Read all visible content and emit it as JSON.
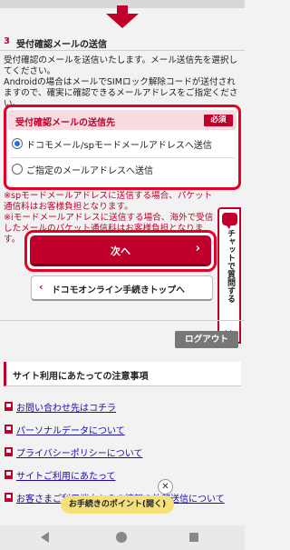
{
  "section": {
    "number": "3",
    "title": "受付確認メールの送信",
    "description": [
      "受付確認のメールを送信いたします。メール送信先を選択してください。",
      "Androidの場合はメールでSIMロック解除コードが送付されますので、確実に確認できるメールアドレスをご指定ください。"
    ]
  },
  "destination": {
    "header": "受付確認メールの送信先",
    "required_badge": "必須",
    "options": [
      {
        "label": "ドコモメール/spモードメールアドレスへ送信",
        "selected": true
      },
      {
        "label": "ご指定のメールアドレスへ送信",
        "selected": false
      }
    ]
  },
  "notes": [
    "※spモードメールアドレスに送信する場合、パケット通信料はお客様負担となります。",
    "※iモードメールアドレスに送信する場合、海外で受信したメールのパケット通信料はお客様負担となります。"
  ],
  "buttons": {
    "next": "次へ",
    "next_chevron": "›",
    "back": "ドコモオンライン手続きトップへ",
    "back_chevron": "‹",
    "logout": "ログアウト"
  },
  "chat": {
    "label": "チャットで質問する",
    "close": "✕"
  },
  "notice_header": "サイト利用にあたっての注意事項",
  "links": [
    "お問い合わせ先はコチラ",
    "パーソナルデータについて",
    "プライバシーポリシーについて",
    "サイトご利用にあたって",
    "お客さまご利用端末からの情報の外部送信について"
  ],
  "guide": {
    "label": "お手続きのポイント(開く)",
    "close": "✕"
  },
  "colors": {
    "brand": "#c0002b",
    "highlight_border": "#e60026",
    "link": "#1a0dab",
    "guide_bg": "#f5e07a"
  },
  "icons": {
    "arrow": "down-arrow-icon",
    "chat": "chat-bubble-icon",
    "link": "page-link-icon"
  }
}
